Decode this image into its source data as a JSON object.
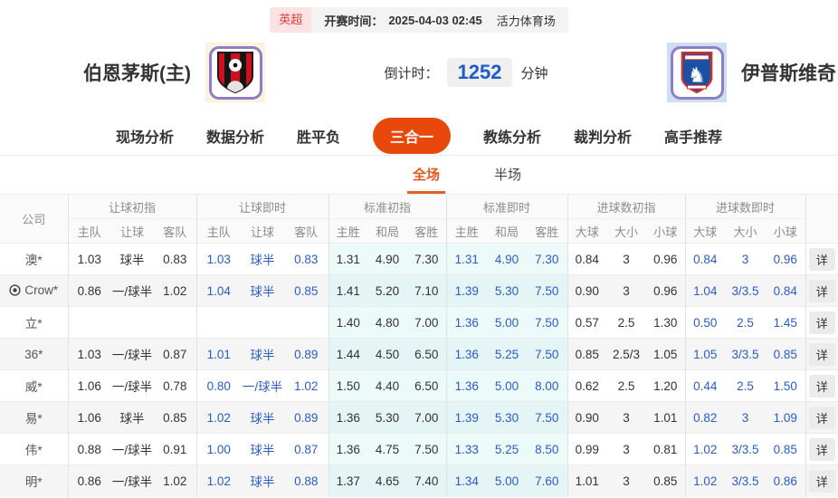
{
  "colors": {
    "accent_orange": "#e8480c",
    "league_red": "#e23b3b",
    "live_blue": "#2a5cc8",
    "standard_tint": "#edfafa"
  },
  "top_bar": {
    "league": "英超",
    "kickoff_label": "开赛时间：",
    "kickoff_time": "2025-04-03 02:45",
    "venue": "活力体育场"
  },
  "match": {
    "home_team": "伯恩茅斯(主)",
    "away_team": "伊普斯维奇",
    "countdown_label": "倒计时：",
    "countdown_minutes": "1252",
    "countdown_unit": "分钟"
  },
  "nav_tabs": [
    {
      "name": "live-analysis",
      "label": "现场分析",
      "active": false
    },
    {
      "name": "data-analysis",
      "label": "数据分析",
      "active": false
    },
    {
      "name": "win-draw-loss",
      "label": "胜平负",
      "active": false
    },
    {
      "name": "three-in-one",
      "label": "三合一",
      "active": true
    },
    {
      "name": "coach-analysis",
      "label": "教练分析",
      "active": false
    },
    {
      "name": "referee-analysis",
      "label": "裁判分析",
      "active": false
    },
    {
      "name": "expert-picks",
      "label": "高手推荐",
      "active": false
    }
  ],
  "sub_tabs": [
    {
      "name": "full-match",
      "label": "全场",
      "active": true
    },
    {
      "name": "half-match",
      "label": "半场",
      "active": false
    }
  ],
  "table": {
    "company_header": "公司",
    "detail_label": "详",
    "groups": [
      {
        "label": "让球初指",
        "cols": [
          "主队",
          "让球",
          "客队"
        ],
        "live": false,
        "tint": false
      },
      {
        "label": "让球即时",
        "cols": [
          "主队",
          "让球",
          "客队"
        ],
        "live": true,
        "tint": false
      },
      {
        "label": "标准初指",
        "cols": [
          "主胜",
          "和局",
          "客胜"
        ],
        "live": false,
        "tint": true
      },
      {
        "label": "标准即时",
        "cols": [
          "主胜",
          "和局",
          "客胜"
        ],
        "live": true,
        "tint": true
      },
      {
        "label": "进球数初指",
        "cols": [
          "大球",
          "大小",
          "小球"
        ],
        "live": false,
        "tint": false
      },
      {
        "label": "进球数即时",
        "cols": [
          "大球",
          "大小",
          "小球"
        ],
        "live": true,
        "tint": false
      }
    ],
    "rows": [
      {
        "company": "澳*",
        "has_icon": false,
        "cells": [
          [
            "1.03",
            "球半",
            "0.83"
          ],
          [
            "1.03",
            "球半",
            "0.83"
          ],
          [
            "1.31",
            "4.90",
            "7.30"
          ],
          [
            "1.31",
            "4.90",
            "7.30"
          ],
          [
            "0.84",
            "3",
            "0.96"
          ],
          [
            "0.84",
            "3",
            "0.96"
          ]
        ]
      },
      {
        "company": "Crow*",
        "has_icon": true,
        "cells": [
          [
            "0.86",
            "一/球半",
            "1.02"
          ],
          [
            "1.04",
            "球半",
            "0.85"
          ],
          [
            "1.41",
            "5.20",
            "7.10"
          ],
          [
            "1.39",
            "5.30",
            "7.50"
          ],
          [
            "0.90",
            "3",
            "0.96"
          ],
          [
            "1.04",
            "3/3.5",
            "0.84"
          ]
        ]
      },
      {
        "company": "立*",
        "has_icon": false,
        "cells": [
          [
            "",
            "",
            ""
          ],
          [
            "",
            "",
            ""
          ],
          [
            "1.40",
            "4.80",
            "7.00"
          ],
          [
            "1.36",
            "5.00",
            "7.50"
          ],
          [
            "0.57",
            "2.5",
            "1.30"
          ],
          [
            "0.50",
            "2.5",
            "1.45"
          ]
        ]
      },
      {
        "company": "36*",
        "has_icon": false,
        "cells": [
          [
            "1.03",
            "一/球半",
            "0.87"
          ],
          [
            "1.01",
            "球半",
            "0.89"
          ],
          [
            "1.44",
            "4.50",
            "6.50"
          ],
          [
            "1.36",
            "5.25",
            "7.50"
          ],
          [
            "0.85",
            "2.5/3",
            "1.05"
          ],
          [
            "1.05",
            "3/3.5",
            "0.85"
          ]
        ]
      },
      {
        "company": "威*",
        "has_icon": false,
        "cells": [
          [
            "1.06",
            "一/球半",
            "0.78"
          ],
          [
            "0.80",
            "一/球半",
            "1.02"
          ],
          [
            "1.50",
            "4.40",
            "6.50"
          ],
          [
            "1.36",
            "5.00",
            "8.00"
          ],
          [
            "0.62",
            "2.5",
            "1.20"
          ],
          [
            "0.44",
            "2.5",
            "1.50"
          ]
        ]
      },
      {
        "company": "易*",
        "has_icon": false,
        "cells": [
          [
            "1.06",
            "球半",
            "0.85"
          ],
          [
            "1.02",
            "球半",
            "0.89"
          ],
          [
            "1.36",
            "5.30",
            "7.00"
          ],
          [
            "1.39",
            "5.30",
            "7.50"
          ],
          [
            "0.90",
            "3",
            "1.01"
          ],
          [
            "0.82",
            "3",
            "1.09"
          ]
        ]
      },
      {
        "company": "伟*",
        "has_icon": false,
        "cells": [
          [
            "0.88",
            "一/球半",
            "0.91"
          ],
          [
            "1.00",
            "球半",
            "0.87"
          ],
          [
            "1.36",
            "4.75",
            "7.50"
          ],
          [
            "1.33",
            "5.25",
            "8.50"
          ],
          [
            "0.99",
            "3",
            "0.81"
          ],
          [
            "1.02",
            "3/3.5",
            "0.85"
          ]
        ]
      },
      {
        "company": "明*",
        "has_icon": false,
        "cells": [
          [
            "0.86",
            "一/球半",
            "1.02"
          ],
          [
            "1.02",
            "球半",
            "0.88"
          ],
          [
            "1.37",
            "4.65",
            "7.40"
          ],
          [
            "1.34",
            "5.00",
            "7.60"
          ],
          [
            "1.01",
            "3",
            "0.85"
          ],
          [
            "1.02",
            "3/3.5",
            "0.86"
          ]
        ]
      }
    ]
  }
}
